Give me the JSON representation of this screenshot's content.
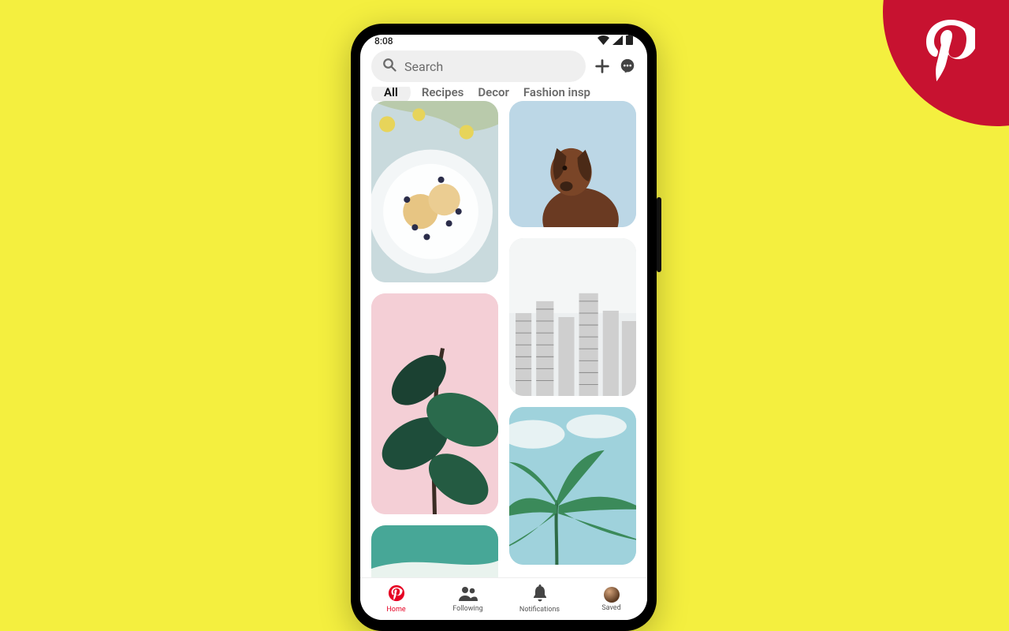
{
  "brand": {
    "name": "pinterest"
  },
  "status": {
    "time": "8:08"
  },
  "search": {
    "placeholder": "Search"
  },
  "tabs": [
    {
      "label": "All",
      "active": true
    },
    {
      "label": "Recipes",
      "active": false
    },
    {
      "label": "Decor",
      "active": false
    },
    {
      "label": "Fashion insp",
      "active": false
    }
  ],
  "nav": [
    {
      "label": "Home",
      "icon": "pinterest",
      "active": true
    },
    {
      "label": "Following",
      "icon": "people",
      "active": false
    },
    {
      "label": "Notifications",
      "icon": "bell",
      "active": false
    },
    {
      "label": "Saved",
      "icon": "avatar",
      "active": false
    }
  ],
  "pins": {
    "col1": [
      "food-plate",
      "pink-plant",
      "beach"
    ],
    "col2": [
      "brown-dog",
      "white-city",
      "palm-sky"
    ]
  }
}
